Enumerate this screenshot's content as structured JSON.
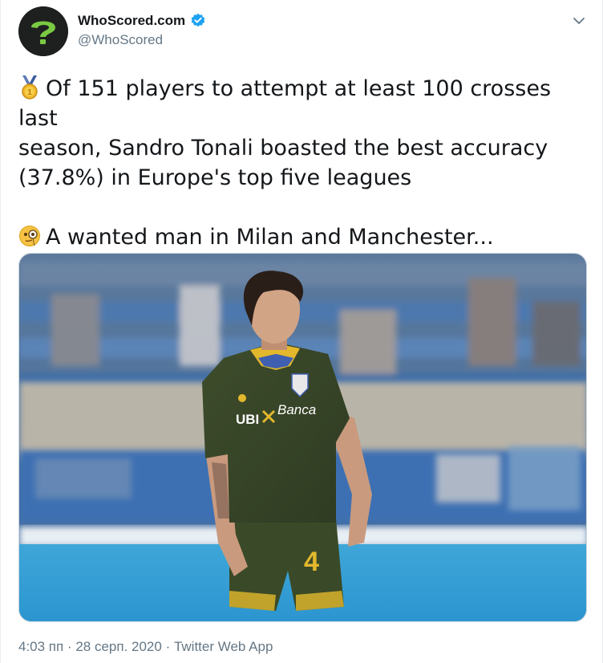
{
  "author": {
    "display_name": "WhoScored.com",
    "handle": "@WhoScored",
    "verified": true,
    "avatar_icon": "question-mark-logo-icon"
  },
  "tweet": {
    "line1": "Of 151 players to attempt at least 100 crosses last",
    "line2": "season, Sandro Tonali boasted the best accuracy",
    "line3": "(37.8%) in Europe's top five leagues",
    "line4": "A wanted man in Milan and Manchester...",
    "emoji1": "1st-place-medal-icon",
    "emoji2": "monocle-face-icon"
  },
  "media": {
    "kit_sponsor_1": "UBI",
    "kit_sponsor_2": "Banca",
    "shirt_number": "4"
  },
  "meta": {
    "timestamp": "4:03 пп · 28 серп. 2020 · Twitter Web App"
  },
  "colors": {
    "brand_blue": "#1da1f2",
    "secondary_text": "#657786",
    "kit_green": "#3a4a2a",
    "kit_yellow": "#e3b82c"
  }
}
